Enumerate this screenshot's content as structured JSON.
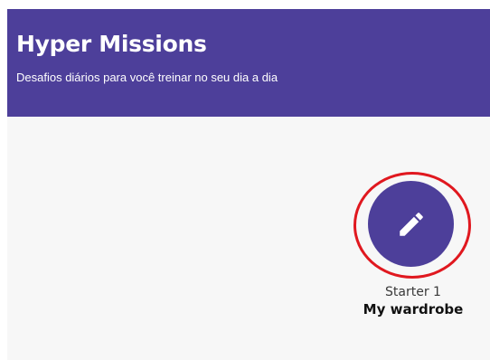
{
  "header": {
    "title": "Hyper Missions",
    "subtitle": "Desafios diários para você treinar no seu dia a dia"
  },
  "missions": [
    {
      "level": "Starter 1",
      "name": "My wardrobe",
      "icon": "pencil-icon",
      "highlighted": true
    }
  ],
  "colors": {
    "brand": "#4d3f9a",
    "highlight": "#e0181f",
    "background": "#f7f7f7",
    "header_text": "#ffffff"
  }
}
